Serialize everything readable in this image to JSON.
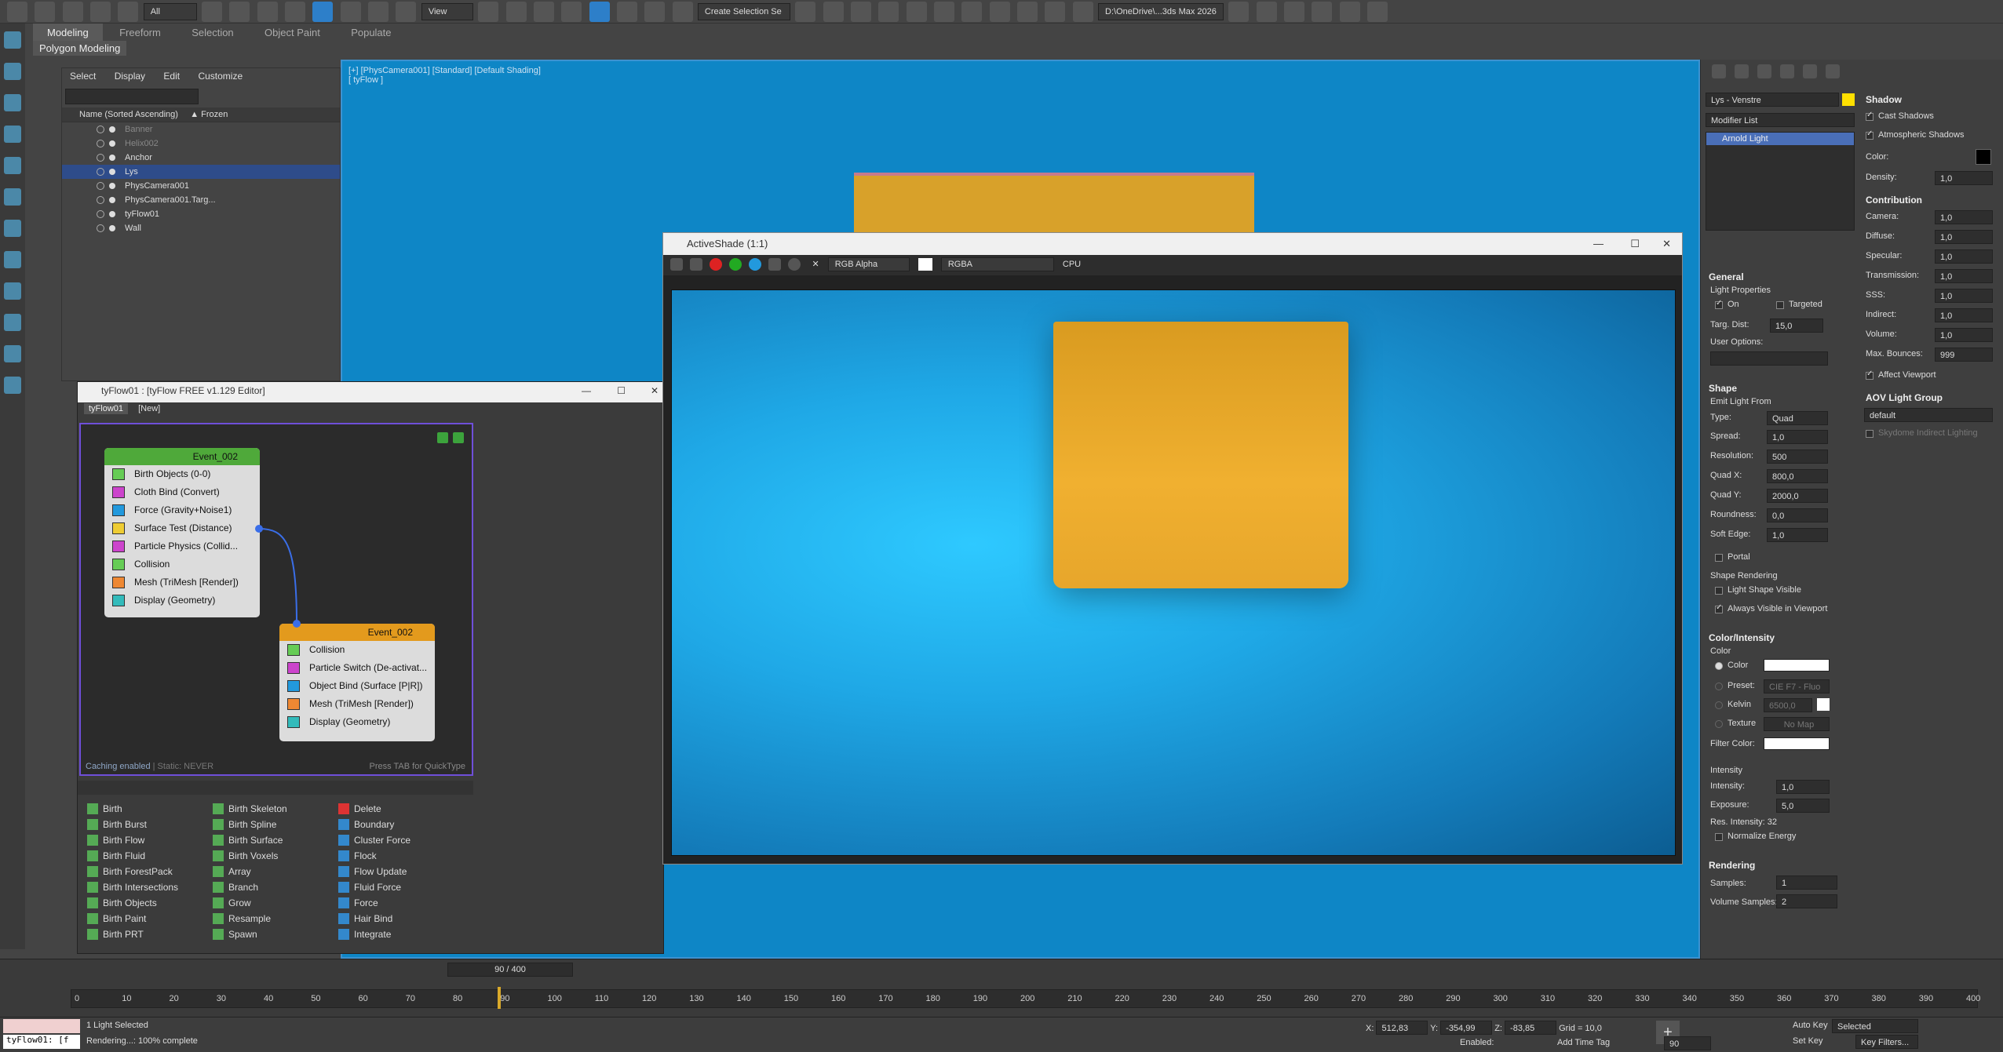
{
  "toolbar": {
    "filter_select": "All",
    "view_select": "View",
    "selection_set": "Create Selection Se",
    "path": "D:\\OneDrive\\...3ds Max 2026"
  },
  "ribbon": {
    "tabs": [
      "Modeling",
      "Freeform",
      "Selection",
      "Object Paint",
      "Populate"
    ],
    "subtab": "Polygon Modeling"
  },
  "scene_explorer": {
    "menu": [
      "Select",
      "Display",
      "Edit",
      "Customize"
    ],
    "col_name": "Name (Sorted Ascending)",
    "col_frozen": "▲ Frozen",
    "rows": [
      {
        "name": "Banner",
        "dim": true,
        "sel": false
      },
      {
        "name": "Helix002",
        "dim": true,
        "sel": false
      },
      {
        "name": "Anchor",
        "dim": false,
        "sel": false
      },
      {
        "name": "Lys",
        "dim": false,
        "sel": true
      },
      {
        "name": "PhysCamera001",
        "dim": false,
        "sel": false
      },
      {
        "name": "PhysCamera001.Targ...",
        "dim": false,
        "sel": false
      },
      {
        "name": "tyFlow01",
        "dim": false,
        "sel": false
      },
      {
        "name": "Wall",
        "dim": false,
        "sel": false
      }
    ]
  },
  "viewport": {
    "label_line1": "[+] [PhysCamera001] [Standard] [Default Shading]",
    "label_line2": "[ tyFlow ]"
  },
  "tyflow": {
    "title": "tyFlow01 : [tyFlow FREE v1.129 Editor]",
    "tab1": "tyFlow01",
    "tab2": "[New]",
    "event1": {
      "title": "Event_002",
      "ops": [
        "Birth Objects (0-0)",
        "Cloth Bind (Convert)",
        "Force (Gravity+Noise1)",
        "Surface Test (Distance)",
        "Particle Physics (Collid...",
        "Collision",
        "Mesh (TriMesh [Render])",
        "Display (Geometry)"
      ]
    },
    "event2": {
      "title": "Event_002",
      "ops": [
        "Collision",
        "Particle Switch (De-activat...",
        "Object Bind (Surface [P|R])",
        "Mesh (TriMesh [Render])",
        "Display (Geometry)"
      ]
    },
    "caching": "Caching enabled",
    "static": "| Static: NEVER",
    "quicktype": "Press TAB for QuickType",
    "operators": {
      "col1": [
        "Birth",
        "Birth Burst",
        "Birth Flow",
        "Birth Fluid",
        "Birth ForestPack",
        "Birth Intersections",
        "Birth Objects",
        "Birth Paint",
        "Birth PRT"
      ],
      "col2": [
        "Birth Skeleton",
        "Birth Spline",
        "Birth Surface",
        "Birth Voxels",
        "Array",
        "Branch",
        "Grow",
        "Resample",
        "Spawn"
      ],
      "col3": [
        "Delete",
        "Boundary",
        "Cluster Force",
        "Flock",
        "Flow Update",
        "Fluid Force",
        "Force",
        "Hair Bind",
        "Integrate"
      ]
    }
  },
  "activeshade": {
    "title": "ActiveShade (1:1)",
    "channel": "RGB Alpha",
    "mode": "RGBA",
    "device": "CPU"
  },
  "command_panel": {
    "object_name": "Lys - Venstre",
    "modifier_list": "Modifier List",
    "stack_item": "Arnold Light",
    "general": {
      "title": "General",
      "light_props": "Light Properties",
      "on": "On",
      "targeted": "Targeted",
      "targ_dist_label": "Targ. Dist:",
      "targ_dist": "15,0",
      "user_options": "User Options:"
    },
    "shape": {
      "title": "Shape",
      "emit_from": "Emit Light From",
      "type_label": "Type:",
      "type": "Quad",
      "params": [
        {
          "label": "Spread:",
          "value": "1,0"
        },
        {
          "label": "Resolution:",
          "value": "500"
        },
        {
          "label": "Quad X:",
          "value": "800,0"
        },
        {
          "label": "Quad Y:",
          "value": "2000,0"
        },
        {
          "label": "Roundness:",
          "value": "0,0"
        },
        {
          "label": "Soft Edge:",
          "value": "1,0"
        }
      ],
      "portal": "Portal",
      "shape_rendering": "Shape Rendering",
      "light_shape_visible": "Light Shape Visible",
      "always_visible": "Always Visible in Viewport"
    },
    "color_intensity": {
      "title": "Color/Intensity",
      "color_header": "Color",
      "color": "Color",
      "preset": "Preset:",
      "preset_value": "CIE F7 - Fluo",
      "kelvin": "Kelvin",
      "kelvin_value": "6500,0",
      "texture": "Texture",
      "texture_value": "No Map",
      "filter_color": "Filter Color:",
      "intensity_header": "Intensity",
      "intensity_label": "Intensity:",
      "intensity": "1,0",
      "exposure_label": "Exposure:",
      "exposure": "5,0",
      "res_intensity": "Res. Intensity: 32",
      "normalize": "Normalize Energy"
    },
    "rendering": {
      "title": "Rendering",
      "samples_label": "Samples:",
      "samples": "1",
      "vol_samples_label": "Volume Samples:",
      "vol_samples": "2"
    },
    "shadow": {
      "title": "Shadow",
      "cast": "Cast Shadows",
      "atmos": "Atmospheric Shadows",
      "color_label": "Color:",
      "density_label": "Density:",
      "density": "1,0"
    },
    "contribution": {
      "title": "Contribution",
      "params": [
        {
          "label": "Camera:",
          "value": "1,0"
        },
        {
          "label": "Diffuse:",
          "value": "1,0"
        },
        {
          "label": "Specular:",
          "value": "1,0"
        },
        {
          "label": "Transmission:",
          "value": "1,0"
        },
        {
          "label": "SSS:",
          "value": "1,0"
        },
        {
          "label": "Indirect:",
          "value": "1,0"
        },
        {
          "label": "Volume:",
          "value": "1,0"
        },
        {
          "label": "Max. Bounces:",
          "value": "999"
        }
      ],
      "affect_viewport": "Affect Viewport"
    },
    "aov": {
      "title": "AOV Light Group",
      "value": "default",
      "skydome": "Skydome Indirect Lighting"
    }
  },
  "timeline": {
    "frame": "90 / 400",
    "ticks": [
      "0",
      "10",
      "20",
      "30",
      "40",
      "50",
      "60",
      "70",
      "80",
      "90",
      "100",
      "110",
      "120",
      "130",
      "140",
      "150",
      "160",
      "170",
      "180",
      "190",
      "200",
      "210",
      "220",
      "230",
      "240",
      "250",
      "260",
      "270",
      "280",
      "290",
      "300",
      "310",
      "320",
      "330",
      "340",
      "350",
      "360",
      "370",
      "380",
      "390",
      "400"
    ]
  },
  "status": {
    "script": "tyFlow01: [f",
    "selected": "1 Light Selected",
    "rendering": "Rendering...: 100% complete",
    "x": "512,83",
    "y": "-354,99",
    "z": "-83,85",
    "grid": "Grid = 10,0",
    "enabled": "Enabled:",
    "add_time_tag": "Add Time Tag",
    "auto_key": "Auto Key",
    "set_key": "Set Key",
    "key_mode": "Selected",
    "key_filters": "Key Filters...",
    "current_frame": "90"
  },
  "colors": {
    "viewport_bg": "#0e86c6",
    "event1_header": "#4fa93a",
    "event2_header": "#e39a1d",
    "cloth": "#e8a62a",
    "graph_border": "#6f4fd9"
  }
}
